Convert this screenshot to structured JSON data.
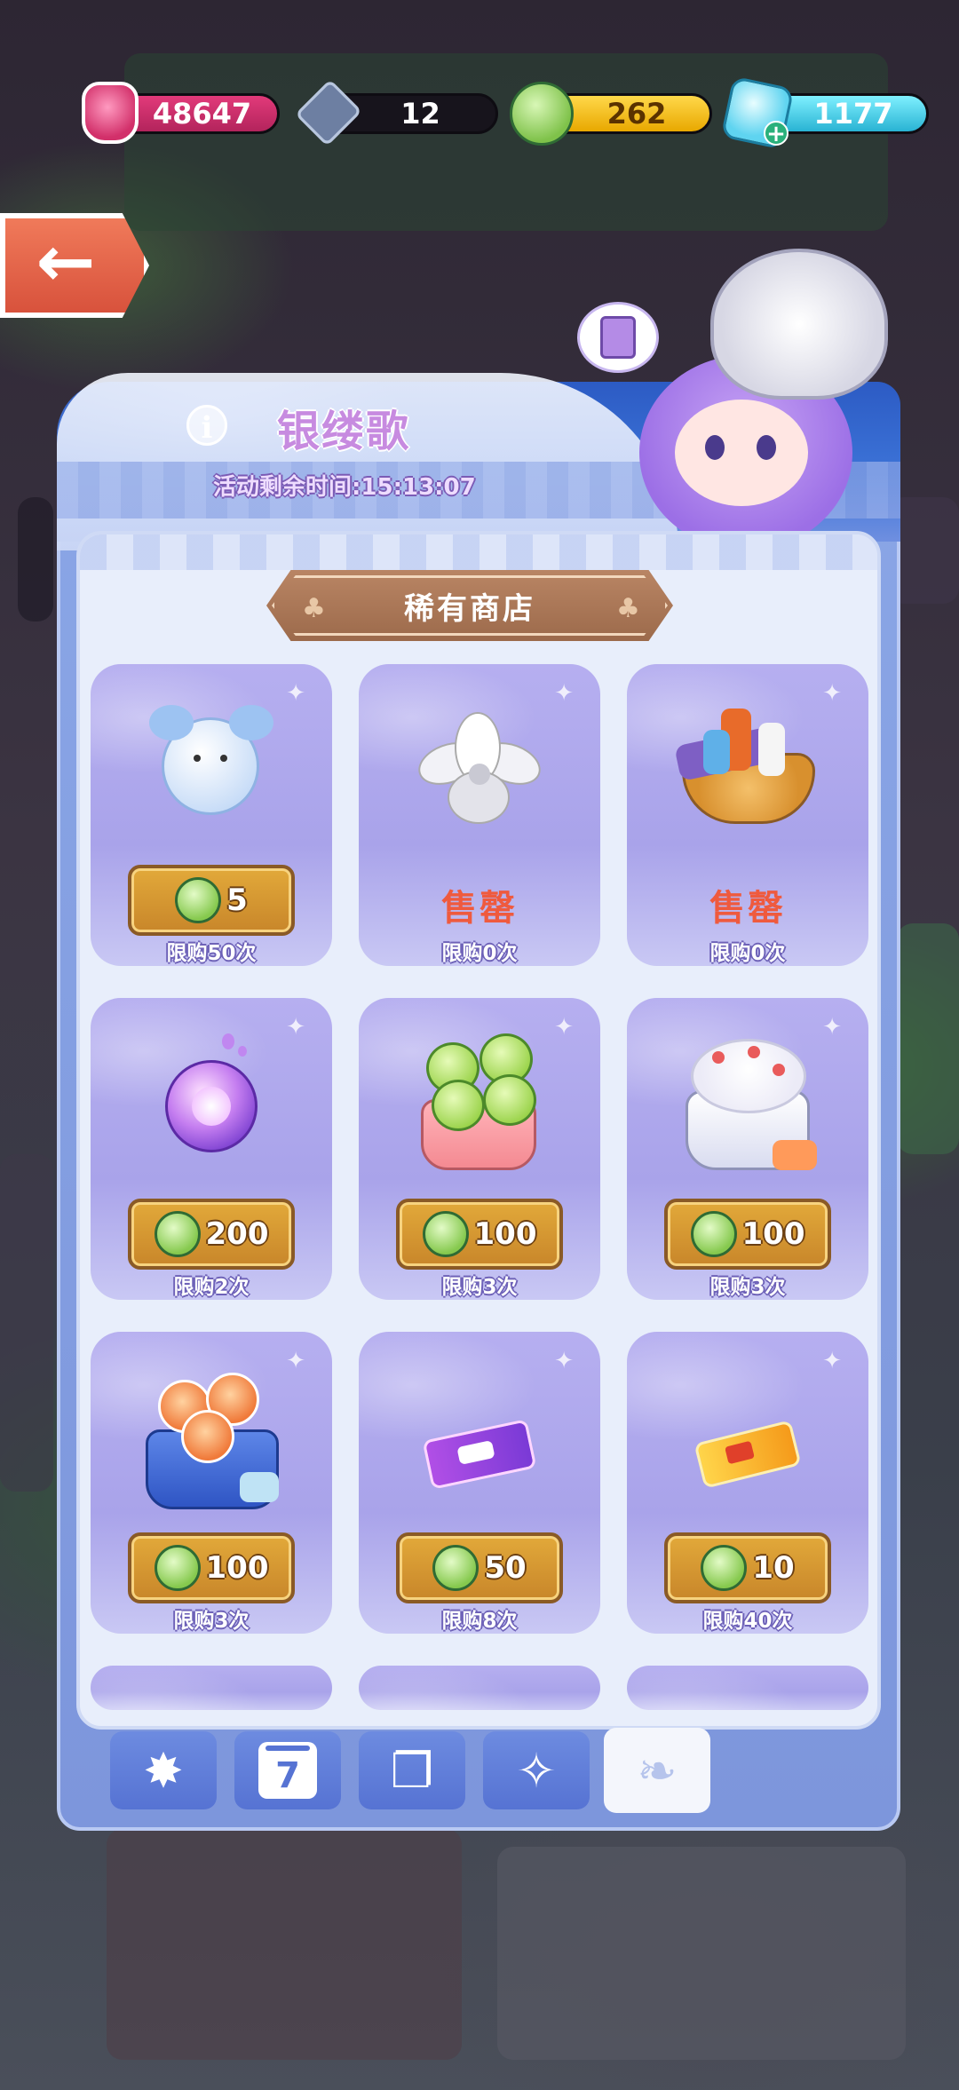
{
  "resources": [
    {
      "name": "jam",
      "value": "48647",
      "color": "#e23a7a"
    },
    {
      "name": "token",
      "value": "12",
      "color": "#17141c"
    },
    {
      "name": "leaf-coin",
      "value": "262",
      "color": "#f7c21c"
    },
    {
      "name": "gem",
      "value": "1177",
      "color": "#46c8e6"
    }
  ],
  "event": {
    "title": "银缕歌",
    "timer": "活动剩余时间:15:13:07"
  },
  "shop": {
    "title": "稀有商店",
    "items": [
      {
        "icon": "snow-bunny-charm-icon",
        "price": "5",
        "limit": "限购50次",
        "sold_out": false
      },
      {
        "icon": "silver-flower-icon",
        "price": "",
        "status": "售罄",
        "limit": "限购0次",
        "sold_out": true
      },
      {
        "icon": "sauce-basket-icon",
        "price": "",
        "status": "售罄",
        "limit": "限购0次",
        "sold_out": true
      },
      {
        "icon": "purple-orb-icon",
        "price": "200",
        "limit": "限购2次",
        "sold_out": false
      },
      {
        "icon": "green-creature-gift-icon",
        "price": "100",
        "limit": "限购3次",
        "sold_out": false
      },
      {
        "icon": "cream-cake-icon",
        "price": "100",
        "limit": "限购3次",
        "sold_out": false
      },
      {
        "icon": "orange-creature-basket-icon",
        "price": "100",
        "limit": "限购3次",
        "sold_out": false
      },
      {
        "icon": "purple-ticket-icon",
        "price": "50",
        "limit": "限购8次",
        "sold_out": false
      },
      {
        "icon": "gold-ticket-icon",
        "price": "10",
        "limit": "限购40次",
        "sold_out": false
      }
    ]
  },
  "tabs": [
    {
      "icon": "spotlight-icon"
    },
    {
      "icon": "calendar-icon",
      "label": "7"
    },
    {
      "icon": "cards-icon"
    },
    {
      "icon": "gift-sparkle-icon"
    },
    {
      "icon": "leaf-icon",
      "active": true
    }
  ]
}
